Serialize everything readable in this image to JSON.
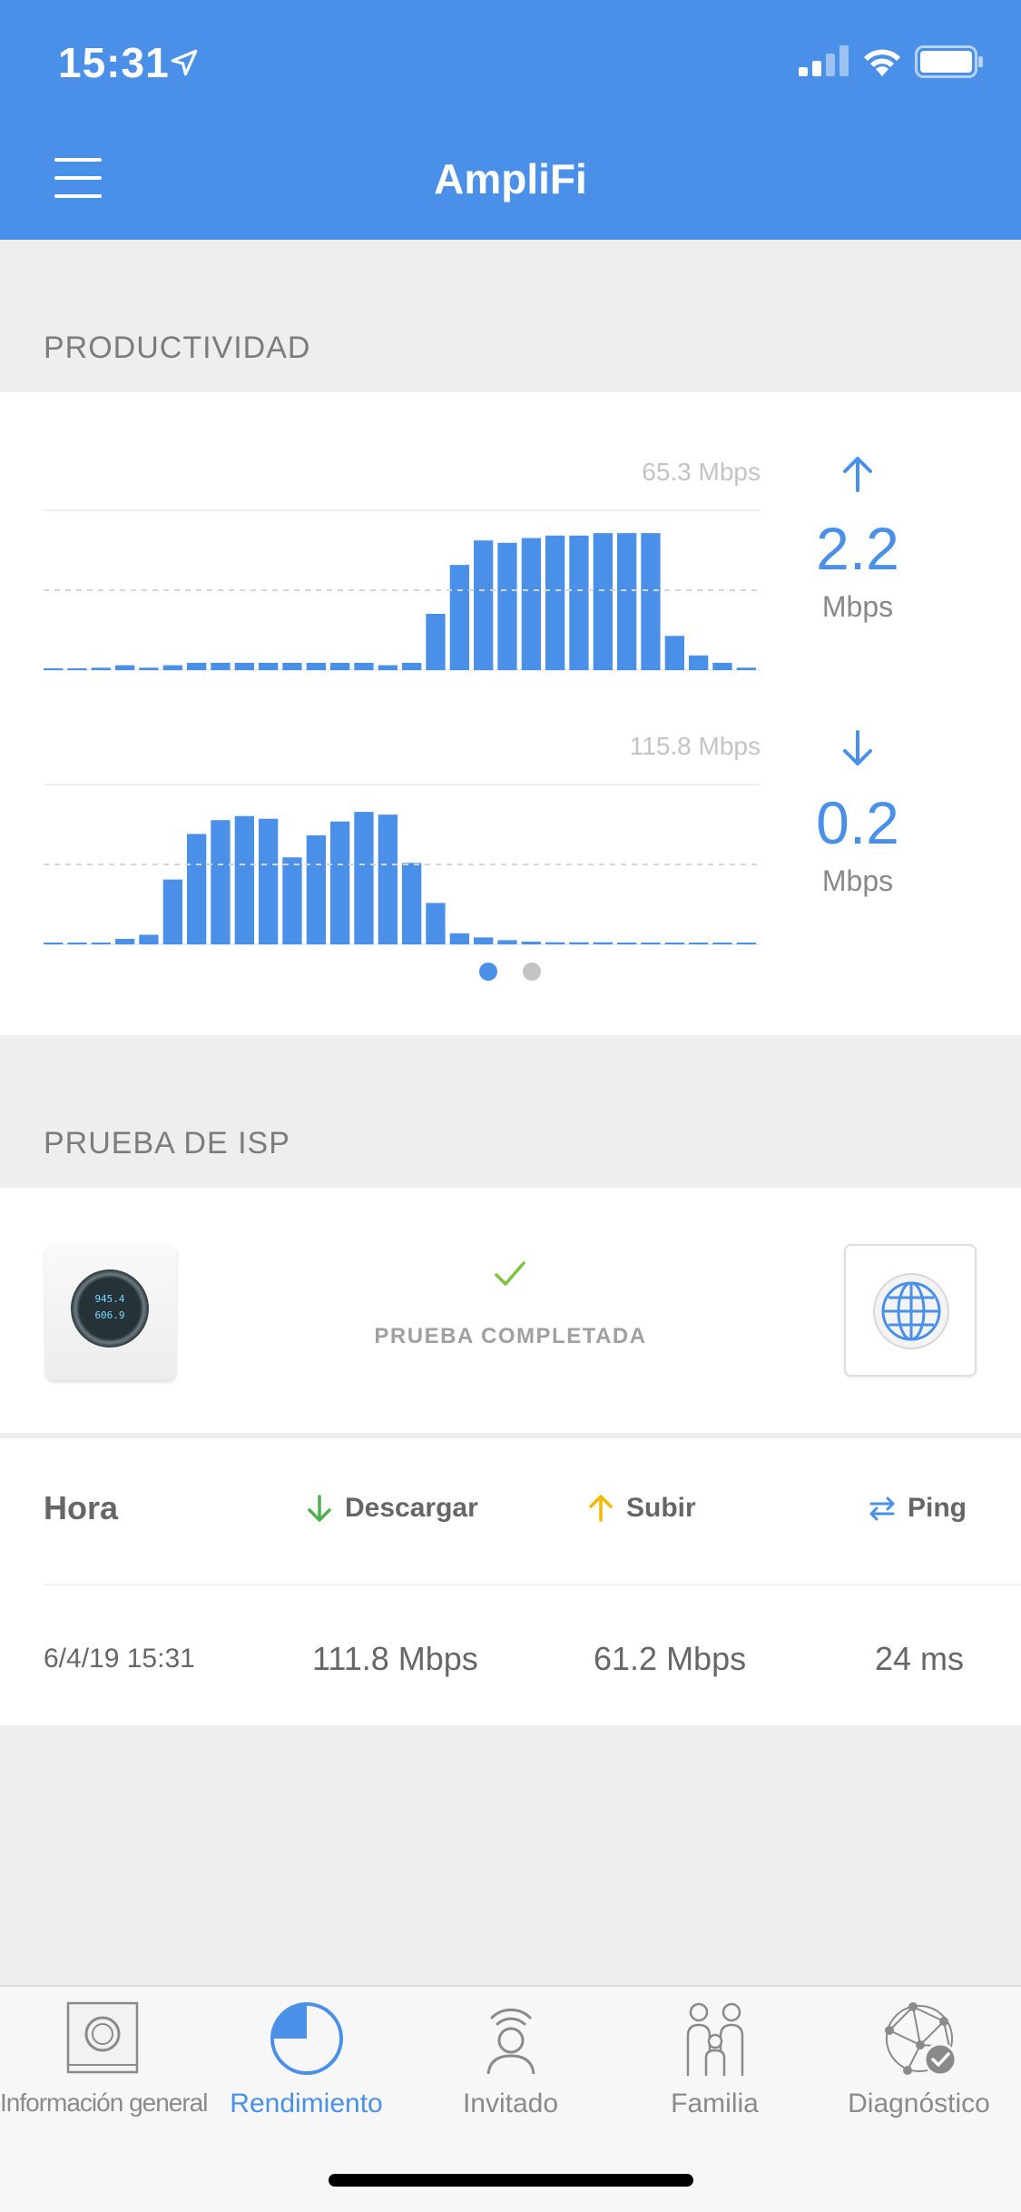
{
  "status_bar": {
    "time": "15:31"
  },
  "header": {
    "title": "AmpliFi"
  },
  "throughput": {
    "section_title": "PRODUCTIVIDAD",
    "upload": {
      "max_label": "65.3 Mbps",
      "value": "2.2",
      "unit": "Mbps"
    },
    "download": {
      "max_label": "115.8 Mbps",
      "value": "0.2",
      "unit": "Mbps"
    },
    "page_count": 2,
    "active_page": 1
  },
  "chart_data": [
    {
      "type": "bar",
      "title": "",
      "ylim": [
        0,
        65.3
      ],
      "values": [
        0.5,
        0.5,
        1,
        2,
        1,
        2,
        3,
        3,
        3,
        3,
        3,
        3,
        3,
        3,
        2,
        3,
        23,
        43,
        53,
        52,
        54,
        55,
        55,
        56,
        56,
        56,
        14,
        6,
        3,
        1
      ]
    },
    {
      "type": "bar",
      "title": "",
      "ylim": [
        0,
        115.8
      ],
      "values": [
        0.5,
        0.5,
        0.5,
        4,
        7,
        47,
        80,
        90,
        93,
        91,
        63,
        79,
        89,
        96,
        94,
        59,
        30,
        8,
        5,
        3,
        2,
        1.5,
        1.5,
        1.5,
        1,
        1,
        0.8,
        0.8,
        0.5,
        0.5
      ]
    }
  ],
  "isp_test": {
    "section_title": "PRUEBA DE ISP",
    "status_label": "PRUEBA COMPLETADA",
    "router_screen": [
      "945.4",
      "606.9"
    ]
  },
  "results": {
    "headers": {
      "time": "Hora",
      "download": "Descargar",
      "upload": "Subir",
      "ping": "Ping"
    },
    "rows": [
      {
        "time": "6/4/19 15:31",
        "download": "111.8 Mbps",
        "upload": "61.2 Mbps",
        "ping": "24 ms"
      }
    ]
  },
  "tabs": [
    {
      "label": "Información general",
      "icon": "router-icon"
    },
    {
      "label": "Rendimiento",
      "icon": "performance-icon"
    },
    {
      "label": "Invitado",
      "icon": "guest-icon"
    },
    {
      "label": "Familia",
      "icon": "family-icon"
    },
    {
      "label": "Diagnóstico",
      "icon": "diagnostics-icon"
    }
  ],
  "active_tab": "Rendimiento",
  "colors": {
    "accent": "#4a90e8",
    "success": "#7cc243",
    "download_arrow": "#4caf50",
    "upload_arrow": "#f5b800",
    "background": "#efeeef"
  }
}
